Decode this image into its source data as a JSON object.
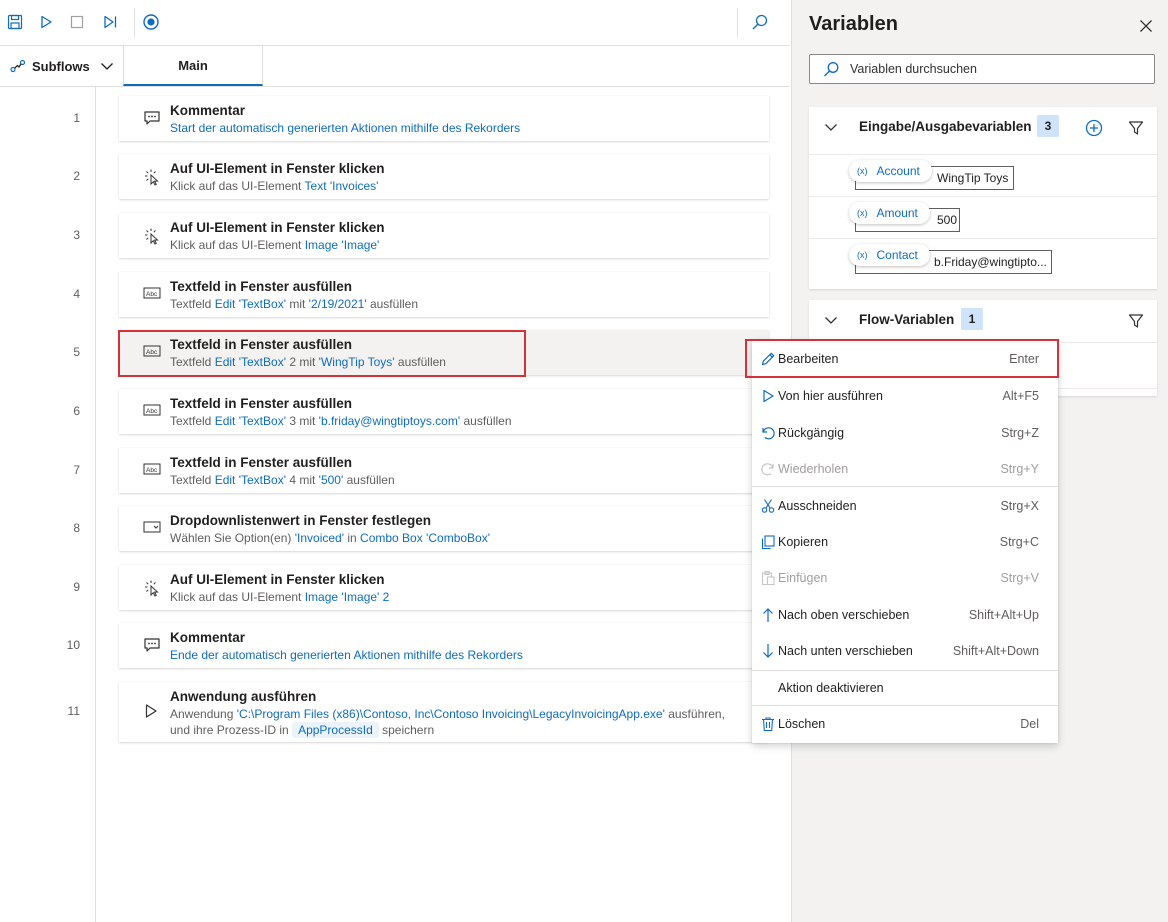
{
  "toolbar": {
    "buttons": [
      "save-icon",
      "run-icon",
      "stop-icon",
      "run-next-action-icon",
      "recorder-icon",
      "search-icon"
    ]
  },
  "tabs": {
    "subflows_label": "Subflows",
    "main_label": "Main"
  },
  "actions": [
    {
      "num": "1",
      "icon": "comment-icon",
      "title": "Kommentar",
      "desc": [
        {
          "t": "Start der automatisch generierten Aktionen mithilfe des Rekorders",
          "link": true
        }
      ]
    },
    {
      "num": "2",
      "icon": "click-icon",
      "title": "Auf UI-Element in Fenster klicken",
      "desc": [
        {
          "t": "Klick auf das UI-Element "
        },
        {
          "t": "Text 'Invoices'",
          "link": true
        }
      ]
    },
    {
      "num": "3",
      "icon": "click-icon",
      "title": "Auf UI-Element in Fenster klicken",
      "desc": [
        {
          "t": "Klick auf das UI-Element "
        },
        {
          "t": "Image 'Image'",
          "link": true
        }
      ]
    },
    {
      "num": "4",
      "icon": "textbox-icon",
      "title": "Textfeld in Fenster ausfüllen",
      "desc": [
        {
          "t": "Textfeld "
        },
        {
          "t": "Edit 'TextBox'",
          "link": true
        },
        {
          "t": " mit "
        },
        {
          "t": "'2/19/2021'",
          "link": true
        },
        {
          "t": " ausfüllen"
        }
      ]
    },
    {
      "num": "5",
      "icon": "textbox-icon",
      "title": "Textfeld in Fenster ausfüllen",
      "desc": [
        {
          "t": "Textfeld "
        },
        {
          "t": "Edit 'TextBox'",
          "link": true
        },
        {
          "t": " 2 mit "
        },
        {
          "t": "'WingTip Toys'",
          "link": true
        },
        {
          "t": " ausfüllen"
        }
      ],
      "selected": true
    },
    {
      "num": "6",
      "icon": "textbox-icon",
      "title": "Textfeld in Fenster ausfüllen",
      "desc": [
        {
          "t": "Textfeld "
        },
        {
          "t": "Edit 'TextBox'",
          "link": true
        },
        {
          "t": " 3 mit "
        },
        {
          "t": "'b.friday@wingtiptoys.com'",
          "link": true
        },
        {
          "t": " ausfüllen"
        }
      ]
    },
    {
      "num": "7",
      "icon": "textbox-icon",
      "title": "Textfeld in Fenster ausfüllen",
      "desc": [
        {
          "t": "Textfeld "
        },
        {
          "t": "Edit 'TextBox'",
          "link": true
        },
        {
          "t": " 4 mit "
        },
        {
          "t": "'500'",
          "link": true
        },
        {
          "t": " ausfüllen"
        }
      ]
    },
    {
      "num": "8",
      "icon": "dropdown-icon",
      "title": "Dropdownlistenwert in Fenster festlegen",
      "desc": [
        {
          "t": "Wählen Sie Option(en) "
        },
        {
          "t": "'Invoiced'",
          "link": true
        },
        {
          "t": " in "
        },
        {
          "t": "Combo Box 'ComboBox'",
          "link": true
        }
      ]
    },
    {
      "num": "9",
      "icon": "click-icon",
      "title": "Auf UI-Element in Fenster klicken",
      "desc": [
        {
          "t": "Klick auf das UI-Element "
        },
        {
          "t": "Image 'Image'",
          "link": true
        },
        {
          "t": " 2",
          "link": true
        }
      ]
    },
    {
      "num": "10",
      "icon": "comment-icon",
      "title": "Kommentar",
      "desc": [
        {
          "t": "Ende der automatisch generierten Aktionen mithilfe des Rekorders",
          "link": true
        }
      ]
    },
    {
      "num": "11",
      "icon": "run-app-icon",
      "title": "Anwendung ausführen",
      "desc": [
        {
          "t": "Anwendung "
        },
        {
          "t": "'C:\\Program Files (x86)\\Contoso, Inc\\Contoso Invoicing\\LegacyInvoicingApp.exe'",
          "link": true
        },
        {
          "t": " ausführen,"
        }
      ],
      "desc2": [
        {
          "t": "und ihre Prozess-ID in "
        },
        {
          "t": "AppProcessId",
          "pill": true
        },
        {
          "t": " speichern"
        }
      ]
    }
  ],
  "variables_panel": {
    "title": "Variablen",
    "search_placeholder": "Variablen durchsuchen",
    "io_section": {
      "title": "Eingabe/Ausgabevariablen",
      "count": "3",
      "vars": [
        {
          "name": "Account",
          "value": "WingTip Toys"
        },
        {
          "name": "Amount",
          "value": "500"
        },
        {
          "name": "Contact",
          "value": "b.Friday@wingtipto..."
        }
      ]
    },
    "flow_section": {
      "title": "Flow-Variablen",
      "count": "1"
    }
  },
  "context_menu": {
    "items": [
      {
        "label": "Bearbeiten",
        "shortcut": "Enter",
        "icon": "pencil-icon",
        "highlighted": true
      },
      {
        "label": "Von hier ausführen",
        "shortcut": "Alt+F5",
        "icon": "run-icon"
      },
      {
        "label": "Rückgängig",
        "shortcut": "Strg+Z",
        "icon": "undo-icon"
      },
      {
        "label": "Wiederholen",
        "shortcut": "Strg+Y",
        "icon": "redo-icon",
        "disabled": true
      },
      {
        "label": "Ausschneiden",
        "shortcut": "Strg+X",
        "icon": "cut-icon"
      },
      {
        "label": "Kopieren",
        "shortcut": "Strg+C",
        "icon": "copy-icon"
      },
      {
        "label": "Einfügen",
        "shortcut": "Strg+V",
        "icon": "paste-icon",
        "disabled": true
      },
      {
        "label": "Nach oben verschieben",
        "shortcut": "Shift+Alt+Up",
        "icon": "arrow-up-icon"
      },
      {
        "label": "Nach unten verschieben",
        "shortcut": "Shift+Alt+Down",
        "icon": "arrow-down-icon"
      },
      {
        "label": "Aktion deaktivieren",
        "shortcut": "",
        "icon": ""
      },
      {
        "label": "Löschen",
        "shortcut": "Del",
        "icon": "trash-icon"
      }
    ]
  },
  "colors": {
    "accent": "#0f6cbd",
    "highlight_border": "#d13438",
    "panel_bg": "#f3f2f1",
    "badge_bg": "#cfe4fa"
  }
}
